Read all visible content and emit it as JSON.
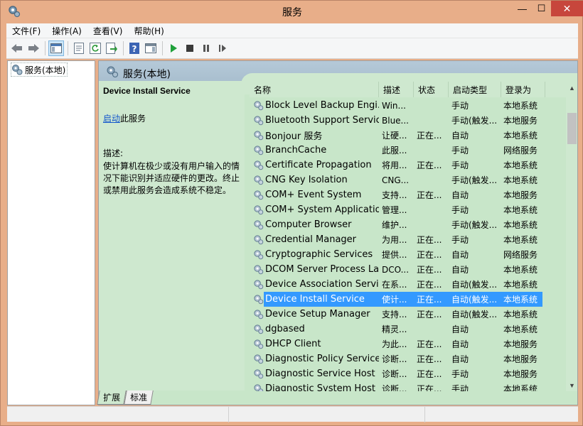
{
  "window": {
    "title": "服务",
    "close_glyph": "✕",
    "min_glyph": "—",
    "max_glyph": "☐"
  },
  "menubar": {
    "items": [
      "文件(F)",
      "操作(A)",
      "查看(V)",
      "帮助(H)"
    ]
  },
  "toolbar": {
    "icons": [
      "back-arrow-icon",
      "forward-arrow-icon",
      "show-hide-tree-icon",
      "properties-icon",
      "refresh-icon",
      "export-list-icon",
      "help-icon",
      "show-action-pane-icon",
      "start-service-icon",
      "stop-service-icon",
      "pause-service-icon",
      "resume-service-icon"
    ]
  },
  "tree": {
    "root_label": "服务(本地)"
  },
  "right_pane": {
    "header_title": "服务(本地)"
  },
  "description": {
    "service_name": "Device Install Service",
    "start_link": "启动",
    "start_suffix": "此服务",
    "label": "描述:",
    "text": "使计算机在极少或没有用户输入的情况下能识别并适应硬件的更改。终止或禁用此服务会造成系统不稳定。"
  },
  "columns": [
    "名称",
    "描述",
    "状态",
    "启动类型",
    "登录为"
  ],
  "services": [
    {
      "name": "Block Level Backup Engi...",
      "desc": "Win...",
      "status": "",
      "startup": "手动",
      "logon": "本地系统"
    },
    {
      "name": "Bluetooth Support Service",
      "desc": "Blue...",
      "status": "",
      "startup": "手动(触发...",
      "logon": "本地服务"
    },
    {
      "name": "Bonjour 服务",
      "desc": "让硬...",
      "status": "正在...",
      "startup": "自动",
      "logon": "本地系统"
    },
    {
      "name": "BranchCache",
      "desc": "此服...",
      "status": "",
      "startup": "手动",
      "logon": "网络服务"
    },
    {
      "name": "Certificate Propagation",
      "desc": "将用...",
      "status": "正在...",
      "startup": "手动",
      "logon": "本地系统"
    },
    {
      "name": "CNG Key Isolation",
      "desc": "CNG...",
      "status": "",
      "startup": "手动(触发...",
      "logon": "本地系统"
    },
    {
      "name": "COM+ Event System",
      "desc": "支持...",
      "status": "正在...",
      "startup": "自动",
      "logon": "本地服务"
    },
    {
      "name": "COM+ System Application",
      "desc": "管理...",
      "status": "",
      "startup": "手动",
      "logon": "本地系统"
    },
    {
      "name": "Computer Browser",
      "desc": "维护...",
      "status": "",
      "startup": "手动(触发...",
      "logon": "本地系统"
    },
    {
      "name": "Credential Manager",
      "desc": "为用...",
      "status": "正在...",
      "startup": "手动",
      "logon": "本地系统"
    },
    {
      "name": "Cryptographic Services",
      "desc": "提供...",
      "status": "正在...",
      "startup": "自动",
      "logon": "网络服务"
    },
    {
      "name": "DCOM Server Process La...",
      "desc": "DCO...",
      "status": "正在...",
      "startup": "自动",
      "logon": "本地系统"
    },
    {
      "name": "Device Association Service",
      "desc": "在系...",
      "status": "正在...",
      "startup": "自动(触发...",
      "logon": "本地系统"
    },
    {
      "name": "Device Install Service",
      "desc": "使计...",
      "status": "正在...",
      "startup": "自动(触发...",
      "logon": "本地系统",
      "selected": true
    },
    {
      "name": "Device Setup Manager",
      "desc": "支持...",
      "status": "正在...",
      "startup": "自动(触发...",
      "logon": "本地系统"
    },
    {
      "name": "dgbased",
      "desc": "精灵...",
      "status": "",
      "startup": "自动",
      "logon": "本地系统"
    },
    {
      "name": "DHCP Client",
      "desc": "为此...",
      "status": "正在...",
      "startup": "自动",
      "logon": "本地服务"
    },
    {
      "name": "Diagnostic Policy Service",
      "desc": "诊断...",
      "status": "正在...",
      "startup": "自动",
      "logon": "本地服务"
    },
    {
      "name": "Diagnostic Service Host",
      "desc": "诊断...",
      "status": "正在...",
      "startup": "手动",
      "logon": "本地服务"
    },
    {
      "name": "Diagnostic System Host",
      "desc": "诊断...",
      "status": "正在...",
      "startup": "手动",
      "logon": "本地系统"
    }
  ],
  "tabs": [
    "扩展",
    "标准"
  ],
  "colors": {
    "frame": "#e8ae89",
    "pane_bg": "#cee8cf",
    "selection": "#3399ff",
    "close_button": "#c7463c"
  }
}
